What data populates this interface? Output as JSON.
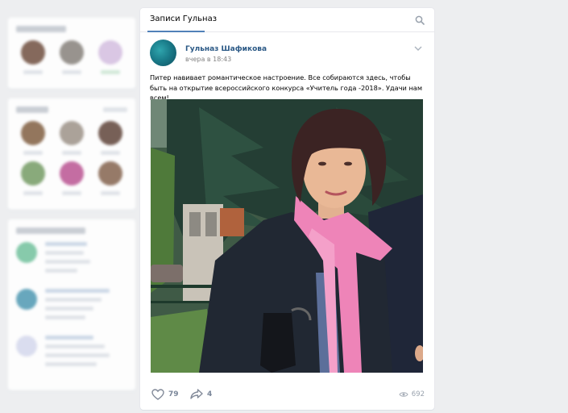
{
  "wall": {
    "tab_label": "Записи Гульназ",
    "search_icon": "search-icon"
  },
  "post": {
    "author": "Гульназ Шафикова",
    "date": "вчера в 18:43",
    "text": "Питер навивает романтическое настроение. Все собираются здесь, чтобы быть на открытие всероссийского конкурса «Учитель года -2018». Удачи нам всем!",
    "likes": "79",
    "shares": "4",
    "views": "692"
  },
  "colors": {
    "accent": "#5181b8",
    "link": "#2a5885",
    "background": "#edeef0"
  }
}
